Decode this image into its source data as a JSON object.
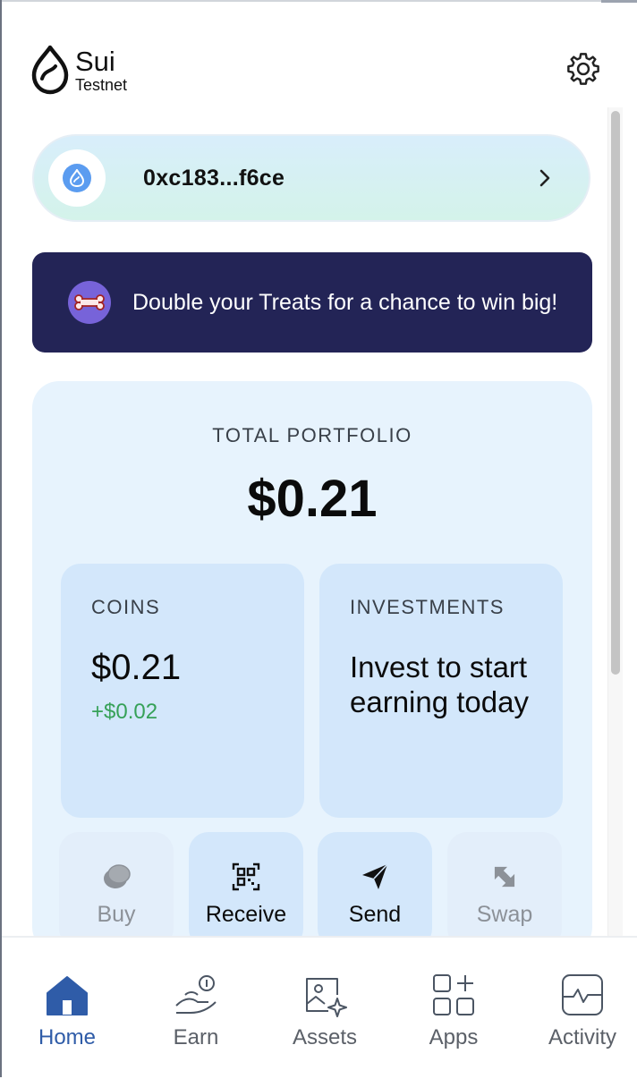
{
  "brand": {
    "name": "Sui",
    "network": "Testnet"
  },
  "account": {
    "address": "0xc183...f6ce"
  },
  "banner": {
    "text": "Double your Treats for a chance to win big!"
  },
  "portfolio": {
    "label": "TOTAL PORTFOLIO",
    "value": "$0.21",
    "coins": {
      "label": "COINS",
      "value": "$0.21",
      "change": "+$0.02"
    },
    "investments": {
      "label": "INVESTMENTS",
      "message": "Invest to start earning today"
    }
  },
  "actions": [
    {
      "label": "Buy",
      "icon": "coin-icon",
      "enabled": false
    },
    {
      "label": "Receive",
      "icon": "qr-code-icon",
      "enabled": true
    },
    {
      "label": "Send",
      "icon": "paper-plane-icon",
      "enabled": true
    },
    {
      "label": "Swap",
      "icon": "swap-arrows-icon",
      "enabled": false
    }
  ],
  "tabs": [
    {
      "label": "Home",
      "icon": "home-icon",
      "active": true
    },
    {
      "label": "Earn",
      "icon": "hand-coin-icon",
      "active": false
    },
    {
      "label": "Assets",
      "icon": "image-sparkle-icon",
      "active": false
    },
    {
      "label": "Apps",
      "icon": "apps-grid-icon",
      "active": false
    },
    {
      "label": "Activity",
      "icon": "pulse-icon",
      "active": false
    }
  ],
  "colors": {
    "accent": "#2f5ca8",
    "banner_bg": "#232456",
    "card_bg": "#d3e7fb",
    "positive": "#36a158"
  }
}
